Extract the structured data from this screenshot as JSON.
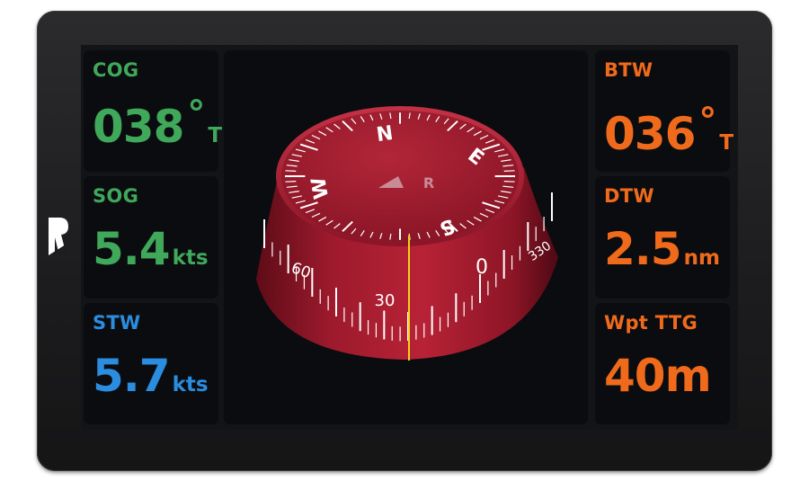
{
  "device": {
    "brand_logo": "R"
  },
  "left_panels": [
    {
      "label": "COG",
      "value": "038",
      "degree": "°",
      "unit": "T",
      "color": "#3fa85a"
    },
    {
      "label": "SOG",
      "value": "5.4",
      "unit": "kts",
      "color": "#3fa85a"
    },
    {
      "label": "STW",
      "value": "5.7",
      "unit": "kts",
      "color": "#2a8de0"
    }
  ],
  "right_panels": [
    {
      "label": "BTW",
      "value": "036",
      "degree": "°",
      "unit": "T",
      "color": "#f06a1c"
    },
    {
      "label": "DTW",
      "value": "2.5",
      "unit": "nm",
      "color": "#f06a1c"
    },
    {
      "label": "Wpt TTG",
      "value": "40m",
      "unit": "",
      "color": "#f06a1c"
    }
  ],
  "compass": {
    "heading_marker_color": "#f2d21a",
    "body_color": "#a41a2e",
    "cardinal_labels": [
      "N",
      "E",
      "S",
      "W"
    ],
    "side_labels": [
      "60",
      "30",
      "0",
      "330"
    ],
    "dial_logo": "R"
  }
}
